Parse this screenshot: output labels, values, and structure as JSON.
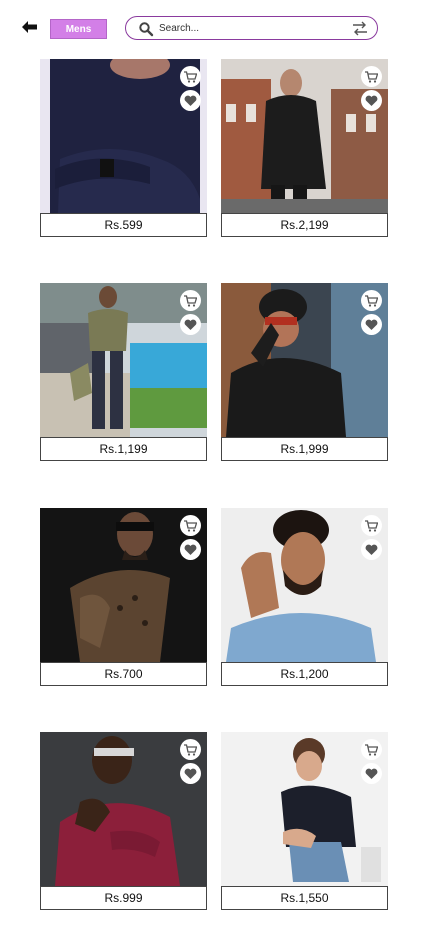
{
  "header": {
    "category_label": "Mens",
    "search_placeholder": "Search..."
  },
  "icons": {
    "back": "back-arrow-icon",
    "search": "search-icon",
    "swap": "swap-icon",
    "cart": "cart-icon",
    "wishlist": "heart-icon"
  },
  "colors": {
    "accent": "#d37fe7",
    "search_border": "#8a3a9e",
    "icon": "#555555"
  },
  "products": [
    {
      "price": "Rs.599"
    },
    {
      "price": "Rs.2,199"
    },
    {
      "price": "Rs.1,199"
    },
    {
      "price": "Rs.1,999"
    },
    {
      "price": "Rs.700"
    },
    {
      "price": "Rs.1,200"
    },
    {
      "price": "Rs.999"
    },
    {
      "price": "Rs.1,550"
    }
  ]
}
